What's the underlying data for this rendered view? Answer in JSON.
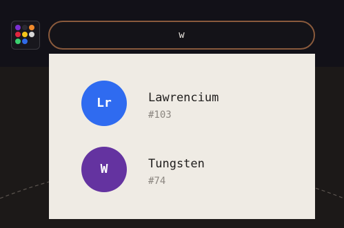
{
  "app_launcher": {
    "icon": "app-grid-icon",
    "dot_colors": [
      "#7b2fd0",
      "#2c2b33",
      "#f08a2c",
      "#e0263f",
      "#f5c518",
      "#d6d6d6",
      "#3bd16f",
      "#2f6ae8"
    ]
  },
  "search": {
    "value": "w",
    "placeholder": ""
  },
  "results": [
    {
      "symbol": "Lr",
      "name": "Lawrencium",
      "number": "#103",
      "color": "#2f6bf0"
    },
    {
      "symbol": "W",
      "name": "Tungsten",
      "number": "#74",
      "color": "#6433a0"
    }
  ]
}
